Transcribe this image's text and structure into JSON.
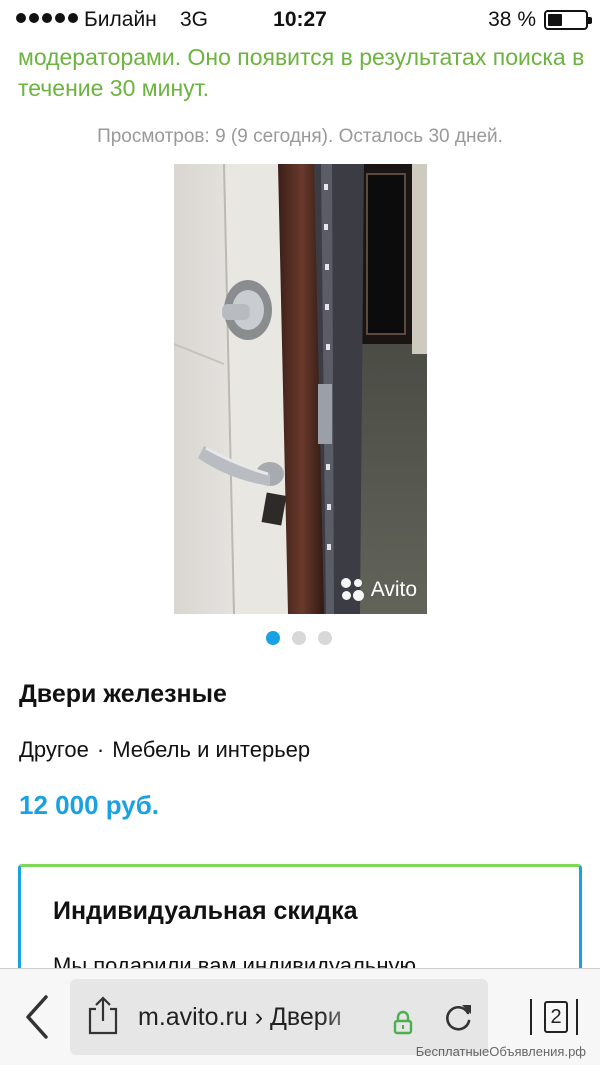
{
  "status_bar": {
    "carrier": "Билайн",
    "network": "3G",
    "time": "10:27",
    "battery": "38 %",
    "battery_level": 0.38
  },
  "notice": {
    "text": "модераторами. Оно появится в результатах поиска в течение 30 минут.",
    "color": "#6db33f"
  },
  "stats": {
    "text": "Просмотров: 9 (9 сегодня). Осталось 30 дней."
  },
  "gallery": {
    "watermark": "Avito",
    "image_subject": "door-photo",
    "pages": 3,
    "active_page": 1
  },
  "listing": {
    "title": "Двери железные",
    "category": "Другое",
    "separator": "·",
    "subcategory": "Мебель и интерьер",
    "price": "12 000 руб.",
    "price_color": "#1aa1e4"
  },
  "discount": {
    "title": "Индивидуальная скидка",
    "body": "Мы подарили вам индивидуальную"
  },
  "browser": {
    "url": "m.avito.ru › Двери",
    "tabs_count": "2",
    "icons": [
      "back-icon",
      "share-icon",
      "lock-icon",
      "reload-icon",
      "tabs-icon"
    ]
  },
  "footer_watermark": "БесплатныеОбъявления.рф"
}
